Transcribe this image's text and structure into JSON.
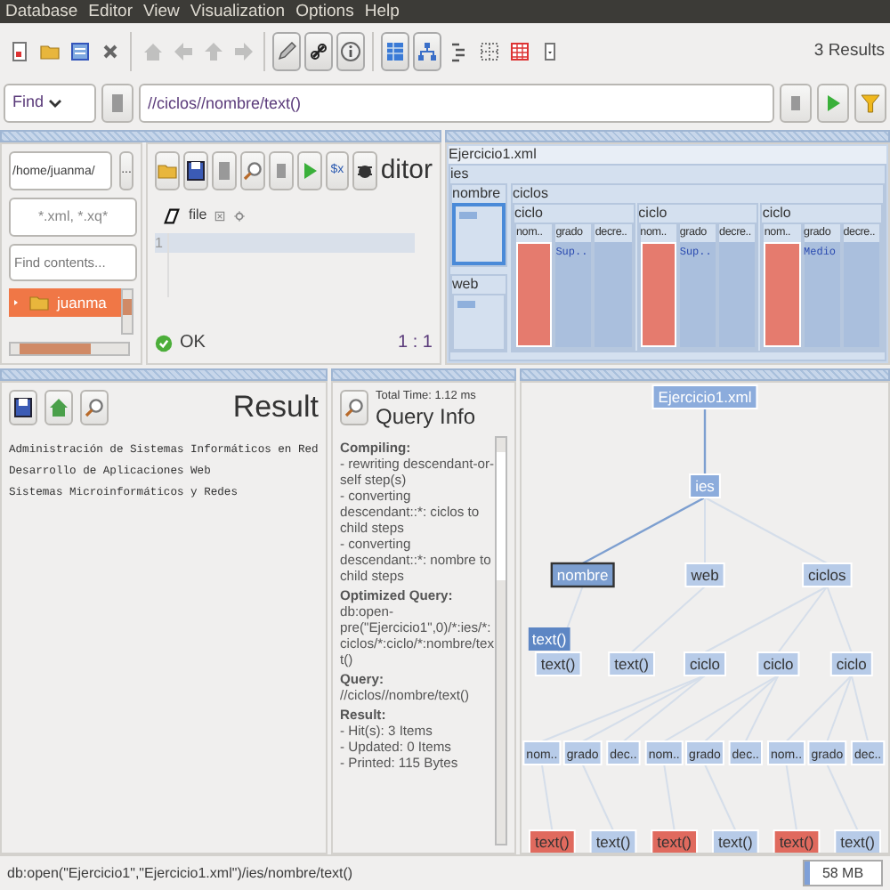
{
  "menu": [
    "Database",
    "Editor",
    "View",
    "Visualization",
    "Options",
    "Help"
  ],
  "toolbar": {
    "buttons": [
      {
        "kind": "new",
        "separator_before": false,
        "pressed": false,
        "disabled": false
      },
      {
        "kind": "open",
        "separator_before": false,
        "pressed": false,
        "disabled": false
      },
      {
        "kind": "properties",
        "separator_before": false,
        "pressed": false,
        "disabled": false
      },
      {
        "kind": "close",
        "separator_before": false,
        "pressed": false,
        "disabled": false
      },
      {
        "kind": "home",
        "separator_before": true,
        "pressed": false,
        "disabled": true
      },
      {
        "kind": "back",
        "separator_before": false,
        "pressed": false,
        "disabled": true
      },
      {
        "kind": "up",
        "separator_before": false,
        "pressed": false,
        "disabled": true
      },
      {
        "kind": "forward",
        "separator_before": false,
        "pressed": false,
        "disabled": true
      },
      {
        "kind": "pencil",
        "separator_before": true,
        "pressed": true,
        "disabled": false
      },
      {
        "kind": "link",
        "separator_before": false,
        "pressed": true,
        "disabled": false
      },
      {
        "kind": "info",
        "separator_before": false,
        "pressed": true,
        "disabled": false
      },
      {
        "kind": "map",
        "separator_before": true,
        "pressed": true,
        "disabled": false
      },
      {
        "kind": "tree",
        "separator_before": false,
        "pressed": true,
        "disabled": false
      },
      {
        "kind": "folders",
        "separator_before": false,
        "pressed": false,
        "disabled": false
      },
      {
        "kind": "dots",
        "separator_before": false,
        "pressed": false,
        "disabled": false
      },
      {
        "kind": "table",
        "separator_before": false,
        "pressed": false,
        "disabled": false
      },
      {
        "kind": "more",
        "separator_before": false,
        "pressed": false,
        "disabled": false
      }
    ],
    "results": "3 Results"
  },
  "find_bar": {
    "mode": "Find",
    "query": "//ciclos//nombre/text()"
  },
  "files": {
    "path": "/home/juanma/",
    "browse": "...",
    "filter": "*.xml, *.xq*",
    "search_placeholder": "Find contents...",
    "items": [
      {
        "label": "juanma",
        "selected": true
      }
    ]
  },
  "editor": {
    "title": "ditor",
    "button_label": "$x",
    "tab": "file",
    "line_numbers": [
      "1"
    ],
    "status": "OK",
    "position": "1 : 1"
  },
  "map": {
    "title": "Ejercicio1.xml",
    "root": "ies",
    "nodes": [
      {
        "label": "nombre",
        "selected": true
      },
      {
        "label": "web",
        "selected": false
      }
    ],
    "group": {
      "label": "ciclos",
      "items": [
        {
          "label": "ciclo",
          "fields": [
            {
              "label": "nom..",
              "hit": true
            },
            {
              "label": "grado",
              "value": "Sup..",
              "hit": false
            },
            {
              "label": "decre..",
              "hit": false
            }
          ]
        },
        {
          "label": "ciclo",
          "fields": [
            {
              "label": "nom..",
              "hit": true
            },
            {
              "label": "grado",
              "value": "Sup..",
              "hit": false
            },
            {
              "label": "decre..",
              "hit": false
            }
          ]
        },
        {
          "label": "ciclo",
          "fields": [
            {
              "label": "nom..",
              "hit": true
            },
            {
              "label": "grado",
              "value": "Medio",
              "hit": false
            },
            {
              "label": "decre..",
              "hit": false
            }
          ]
        }
      ]
    }
  },
  "result": {
    "title": "Result",
    "lines": [
      "Administración de Sistemas Informáticos en Red",
      "Desarrollo de Aplicaciones Web",
      "Sistemas Microinformáticos y Redes"
    ]
  },
  "query_info": {
    "title": "Query Info",
    "total_time": "Total Time: 1.12 ms",
    "sections": [
      {
        "heading": "Compiling:",
        "lines": [
          "- rewriting descendant-or-self step(s)",
          "- converting descendant::*: ciclos to child steps",
          "- converting descendant::*: nombre to child steps"
        ]
      },
      {
        "heading": "Optimized Query:",
        "lines": [
          "db:open-pre(\"Ejercicio1\",0)/*:ies/*:ciclos/*:ciclo/*:nombre/text()"
        ]
      },
      {
        "heading": "Query:",
        "lines": [
          "//ciclos//nombre/text()"
        ]
      },
      {
        "heading": "Result:",
        "lines": [
          "- Hit(s): 3 Items",
          "- Updated: 0 Items",
          "- Printed: 115 Bytes"
        ]
      }
    ]
  },
  "tree": {
    "tooltip": "text()",
    "root": {
      "label": "Ejercicio1.xml",
      "selected": false,
      "hit": false,
      "children": [
        {
          "label": "ies",
          "selected": false,
          "hit": false,
          "children": [
            {
              "label": "nombre",
              "selected": true,
              "hit": false,
              "children": [
                {
                  "label": "text()",
                  "selected": false,
                  "hit": false
                }
              ]
            },
            {
              "label": "web",
              "selected": false,
              "hit": false,
              "children": [
                {
                  "label": "text()",
                  "selected": false,
                  "hit": false
                }
              ]
            },
            {
              "label": "ciclos",
              "selected": false,
              "hit": false,
              "children": [
                {
                  "label": "ciclo",
                  "selected": false,
                  "hit": false,
                  "children": [
                    {
                      "label": "nom..",
                      "selected": false,
                      "hit": false,
                      "children": [
                        {
                          "label": "text()",
                          "selected": false,
                          "hit": true
                        }
                      ]
                    },
                    {
                      "label": "grado",
                      "selected": false,
                      "hit": false,
                      "children": [
                        {
                          "label": "text()",
                          "selected": false,
                          "hit": false
                        }
                      ]
                    },
                    {
                      "label": "dec..",
                      "selected": false,
                      "hit": false
                    }
                  ]
                },
                {
                  "label": "ciclo",
                  "selected": false,
                  "hit": false,
                  "children": [
                    {
                      "label": "nom..",
                      "selected": false,
                      "hit": false,
                      "children": [
                        {
                          "label": "text()",
                          "selected": false,
                          "hit": true
                        }
                      ]
                    },
                    {
                      "label": "grado",
                      "selected": false,
                      "hit": false,
                      "children": [
                        {
                          "label": "text()",
                          "selected": false,
                          "hit": false
                        }
                      ]
                    },
                    {
                      "label": "dec..",
                      "selected": false,
                      "hit": false
                    }
                  ]
                },
                {
                  "label": "ciclo",
                  "selected": false,
                  "hit": false,
                  "children": [
                    {
                      "label": "nom..",
                      "selected": false,
                      "hit": false,
                      "children": [
                        {
                          "label": "text()",
                          "selected": false,
                          "hit": true
                        }
                      ]
                    },
                    {
                      "label": "grado",
                      "selected": false,
                      "hit": false,
                      "children": [
                        {
                          "label": "text()",
                          "selected": false,
                          "hit": false
                        }
                      ]
                    },
                    {
                      "label": "dec..",
                      "selected": false,
                      "hit": false
                    }
                  ]
                }
              ]
            }
          ]
        }
      ]
    }
  },
  "status_bar": {
    "text": "db:open(\"Ejercicio1\",\"Ejercicio1.xml\")/ies/nombre/text()",
    "memory": {
      "reading": "58 MB",
      "level": 0.06
    }
  }
}
